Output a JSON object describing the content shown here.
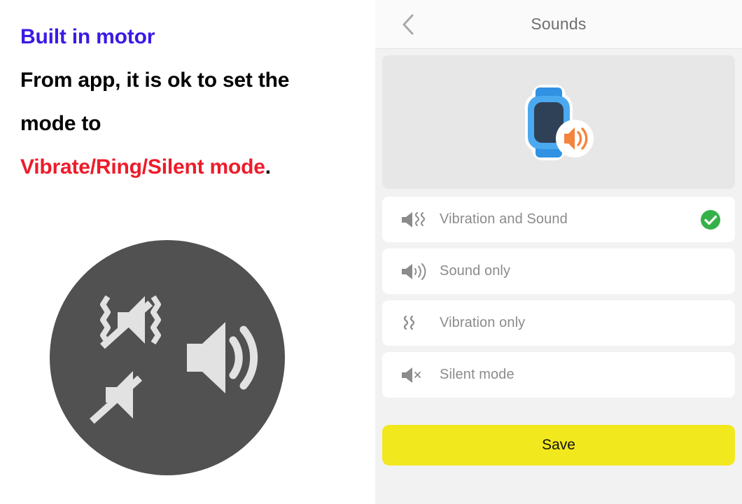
{
  "annotation": {
    "title": "Built in motor",
    "body_line1": "From app, it is ok to set the",
    "body_line2": "mode to",
    "accent_text": "Vibrate/Ring/Silent mode",
    "accent_period": ".",
    "title_color": "#3b19e6",
    "accent_color": "#ee1b2a",
    "body_color": "#000000"
  },
  "mode_badge": {
    "icon_name": "sound-modes-badge",
    "circle_color": "#515151",
    "glyph_color": "#e2e2e2",
    "glyphs": [
      "vibrate-off-icon",
      "speaker-muted-icon",
      "speaker-loud-icon"
    ]
  },
  "phone": {
    "header": {
      "back_icon": "chevron-left-icon",
      "title": "Sounds",
      "background": "#fafafa",
      "title_color": "#6e6e6e"
    },
    "hero": {
      "illustration_name": "smartwatch-with-speaker-badge",
      "card_background": "#e7e7e7",
      "watch_band_color": "#2f8fe0",
      "watch_body_color": "#4ba3ee",
      "watch_screen_color": "#2f4157",
      "badge_background": "#ffffff",
      "badge_icon_color": "#f4833c",
      "badge_icon_name": "speaker-on-icon"
    },
    "options": [
      {
        "label": "Vibration and Sound",
        "icon": "speaker-vibration-icon",
        "selected": true
      },
      {
        "label": "Sound only",
        "icon": "speaker-waves-icon",
        "selected": false
      },
      {
        "label": "Vibration only",
        "icon": "vibration-waves-icon",
        "selected": false
      },
      {
        "label": "Silent mode",
        "icon": "speaker-mute-icon",
        "selected": false
      }
    ],
    "check_color": "#35b14a",
    "save": {
      "label": "Save",
      "background": "#f2e81e",
      "text_color": "#111111"
    },
    "panel_background": "#f2f2f2",
    "row_background": "#ffffff",
    "label_color": "#8b8b8b"
  }
}
